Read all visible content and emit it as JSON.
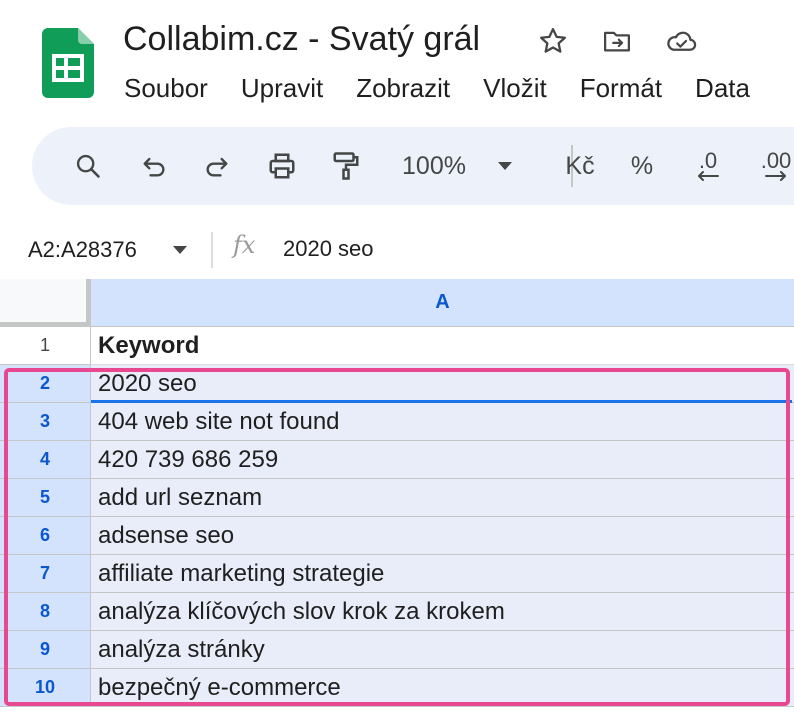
{
  "header": {
    "title": "Collabim.cz - Svatý grál",
    "menu": [
      "Soubor",
      "Upravit",
      "Zobrazit",
      "Vložit",
      "Formát",
      "Data"
    ],
    "title_icons": [
      "star-icon",
      "move-to-folder-icon",
      "cloud-saved-icon"
    ]
  },
  "toolbar": {
    "zoom": "100%",
    "currency": "Kč",
    "percent": "%",
    "decrease_decimals": ".0",
    "increase_decimals": ".00"
  },
  "formula_bar": {
    "name_box": "A2:A28376",
    "fx": "fx",
    "value": "2020 seo"
  },
  "grid": {
    "column_headers": [
      "A"
    ],
    "rows": [
      {
        "num": "1",
        "value": "Keyword"
      },
      {
        "num": "2",
        "value": "2020 seo"
      },
      {
        "num": "3",
        "value": "404 web site not found"
      },
      {
        "num": "4",
        "value": "420 739 686 259"
      },
      {
        "num": "5",
        "value": "add url seznam"
      },
      {
        "num": "6",
        "value": "adsense seo"
      },
      {
        "num": "7",
        "value": "affiliate marketing strategie"
      },
      {
        "num": "8",
        "value": "analýza klíčových slov krok za krokem"
      },
      {
        "num": "9",
        "value": "analýza stránky"
      },
      {
        "num": "10",
        "value": "bezpečný e-commerce"
      }
    ]
  },
  "colors": {
    "accent": "#1a73e8",
    "selection": "#d3e3fd",
    "highlight_box": "#e8488f",
    "logo_green": "#0f9d58"
  }
}
